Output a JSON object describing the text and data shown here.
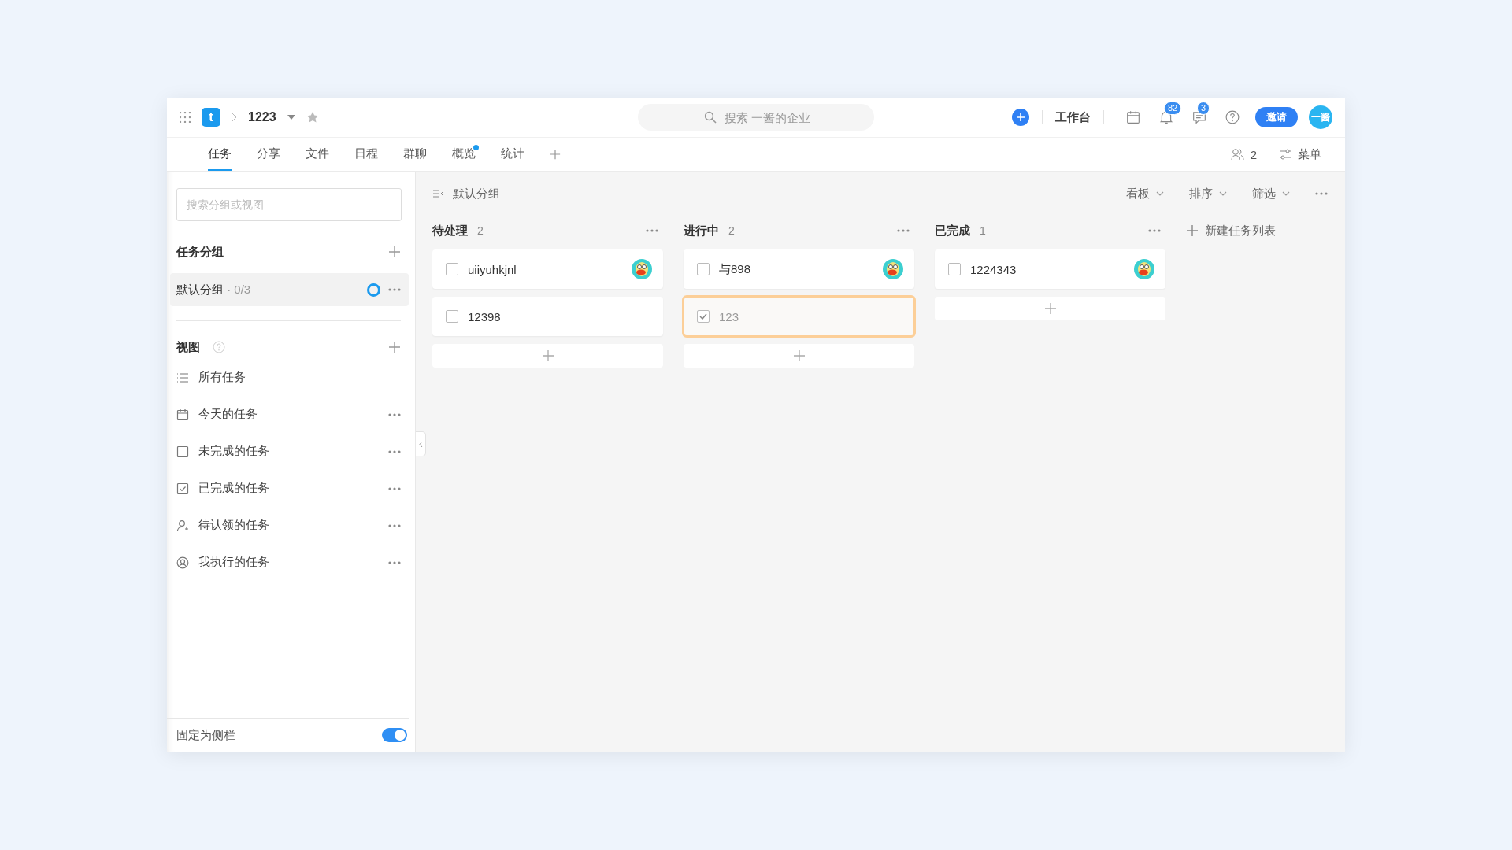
{
  "header": {
    "logo": "t",
    "project": "1223",
    "starred": false,
    "search": {
      "placeholder": "搜索 一酱的企业"
    },
    "workbench": "工作台",
    "notifications": "82",
    "messages": "3",
    "invite": "邀请",
    "user": "一酱"
  },
  "tabs": [
    {
      "label": "任务",
      "selected": true,
      "dot": false
    },
    {
      "label": "分享",
      "selected": false,
      "dot": false
    },
    {
      "label": "文件",
      "selected": false,
      "dot": false
    },
    {
      "label": "日程",
      "selected": false,
      "dot": false
    },
    {
      "label": "群聊",
      "selected": false,
      "dot": false
    },
    {
      "label": "概览",
      "selected": false,
      "dot": true
    },
    {
      "label": "统计",
      "selected": false,
      "dot": false
    }
  ],
  "members": "2",
  "menu": "菜单",
  "sidebar": {
    "search": {
      "placeholder": "搜索分组或视图"
    },
    "groups_title": "任务分组",
    "groups": [
      {
        "name": "默认分组",
        "progress": "· 0/3",
        "selected": true
      }
    ],
    "views_title": "视图",
    "views": [
      {
        "kind": "list",
        "label": "所有任务",
        "more": false
      },
      {
        "kind": "calendar",
        "label": "今天的任务",
        "more": true
      },
      {
        "kind": "checkbox",
        "label": "未完成的任务",
        "more": true
      },
      {
        "kind": "checked",
        "label": "已完成的任务",
        "more": true
      },
      {
        "kind": "claim",
        "label": "待认领的任务",
        "more": true
      },
      {
        "kind": "user",
        "label": "我执行的任务",
        "more": true
      }
    ],
    "pin": {
      "label": "固定为侧栏",
      "on": true
    }
  },
  "board": {
    "group": "默认分组",
    "controls": [
      "看板",
      "排序",
      "筛选"
    ],
    "columns": [
      {
        "title": "待处理",
        "count": "2",
        "cards": [
          {
            "title": "uiiyuhkjnl",
            "checked": false,
            "assigned": true,
            "highlighted": false
          },
          {
            "title": "12398",
            "checked": false,
            "assigned": false,
            "highlighted": false
          }
        ]
      },
      {
        "title": "进行中",
        "count": "2",
        "cards": [
          {
            "title": "与898",
            "checked": false,
            "assigned": true,
            "highlighted": false
          },
          {
            "title": "123",
            "checked": true,
            "assigned": false,
            "highlighted": true
          }
        ]
      },
      {
        "title": "已完成",
        "count": "1",
        "cards": [
          {
            "title": "1224343",
            "checked": false,
            "assigned": true,
            "highlighted": false
          }
        ]
      }
    ],
    "new_list": "新建任务列表"
  }
}
